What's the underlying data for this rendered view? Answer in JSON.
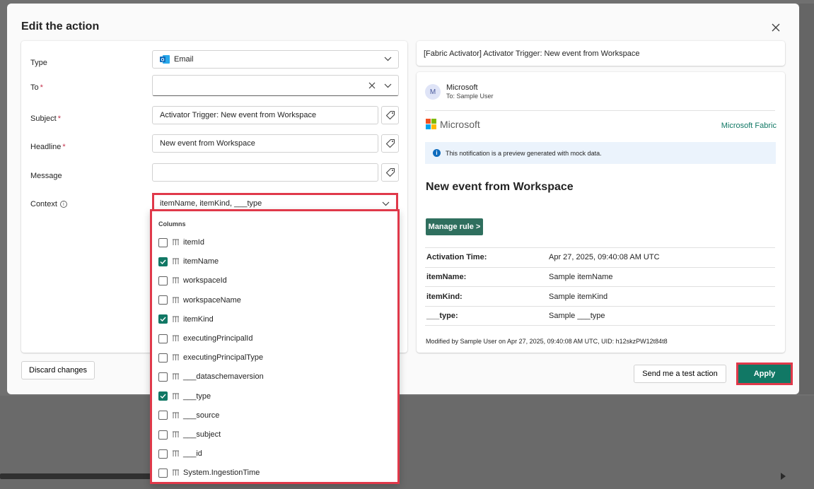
{
  "dialog": {
    "title": "Edit the action",
    "discard_label": "Discard changes",
    "test_label": "Send me a test action",
    "apply_label": "Apply"
  },
  "form": {
    "type_label": "Type",
    "type_value": "Email",
    "to_label": "To",
    "to_value": "",
    "subject_label": "Subject",
    "subject_value": "Activator Trigger: New event from Workspace",
    "headline_label": "Headline",
    "headline_value": "New event from Workspace",
    "message_label": "Message",
    "message_value": "",
    "context_label": "Context",
    "context_value": "itemName, itemKind, ___type",
    "required_mark": "*"
  },
  "dropdown": {
    "header": "Columns",
    "items": [
      {
        "label": "itemId",
        "checked": false
      },
      {
        "label": "itemName",
        "checked": true
      },
      {
        "label": "workspaceId",
        "checked": false
      },
      {
        "label": "workspaceName",
        "checked": false
      },
      {
        "label": "itemKind",
        "checked": true
      },
      {
        "label": "executingPrincipalId",
        "checked": false
      },
      {
        "label": "executingPrincipalType",
        "checked": false
      },
      {
        "label": "___dataschemaversion",
        "checked": false
      },
      {
        "label": "___type",
        "checked": true
      },
      {
        "label": "___source",
        "checked": false
      },
      {
        "label": "___subject",
        "checked": false
      },
      {
        "label": "___id",
        "checked": false
      },
      {
        "label": "System.IngestionTime",
        "checked": false
      }
    ]
  },
  "preview": {
    "subject_line": "[Fabric Activator] Activator Trigger: New event from Workspace",
    "avatar_initial": "M",
    "sender": "Microsoft",
    "recipient": "To: Sample User",
    "brand": "Microsoft",
    "product": "Microsoft Fabric",
    "notice": "This notification is a preview generated with mock data.",
    "headline": "New event from Workspace",
    "manage_label": "Manage rule >",
    "properties": [
      {
        "label": "Activation Time:",
        "value": "Apr 27, 2025, 09:40:08 AM UTC"
      },
      {
        "label": "itemName:",
        "value": "Sample itemName"
      },
      {
        "label": "itemKind:",
        "value": "Sample itemKind"
      },
      {
        "label": "___type:",
        "value": "Sample ___type"
      }
    ],
    "footer": "Modified by Sample User on Apr 27, 2025, 09:40:08 AM UTC, UID: h12skzPW12t84t8"
  },
  "colors": {
    "accent": "#117865",
    "highlight": "#e0394a",
    "outlook_blue": "#0f6cbd"
  }
}
